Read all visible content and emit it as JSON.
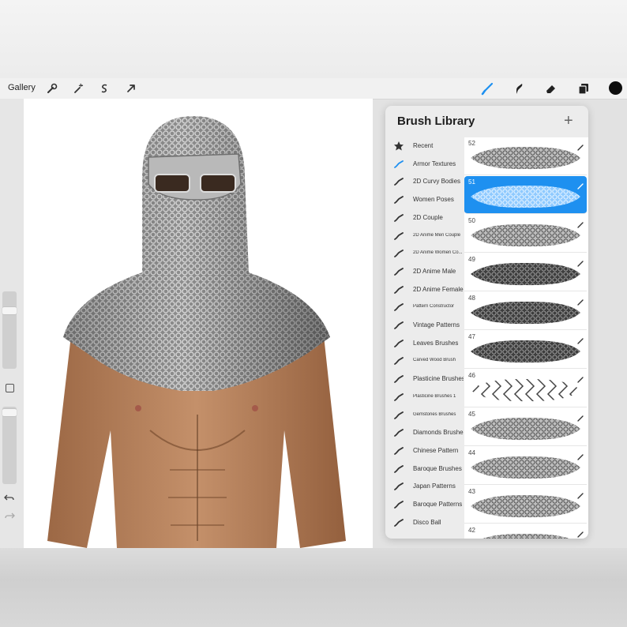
{
  "toolbar": {
    "gallery_label": "Gallery",
    "icons": [
      "wrench-icon",
      "magic-wand-icon",
      "selection-s-icon",
      "arrow-cursor-icon",
      "brush-icon",
      "smudge-icon",
      "eraser-icon",
      "layers-icon"
    ],
    "active_tool": "brush-icon",
    "accent_color": "#1e90f0",
    "current_color": "#0d0d0d"
  },
  "brush_library": {
    "title": "Brush Library",
    "add_label": "+",
    "sets": [
      {
        "label": "Recent",
        "icon": "star-icon"
      },
      {
        "label": "Armor Textures",
        "icon": "brush-stroke-icon",
        "active": true
      },
      {
        "label": "2D Curvy Bodies",
        "icon": "brush-stroke-icon"
      },
      {
        "label": "Women Poses",
        "icon": "brush-stroke-icon"
      },
      {
        "label": "2D Couple",
        "icon": "brush-stroke-icon"
      },
      {
        "label": "2D Anime Men Couple",
        "icon": "brush-stroke-icon",
        "small": true
      },
      {
        "label": "2D Anime Women Co...",
        "icon": "brush-stroke-icon",
        "small": true
      },
      {
        "label": "2D Anime Male",
        "icon": "brush-stroke-icon"
      },
      {
        "label": "2D Anime Female",
        "icon": "brush-stroke-icon"
      },
      {
        "label": "Pattern Constructor",
        "icon": "brush-stroke-icon",
        "small": true
      },
      {
        "label": "Vintage Patterns",
        "icon": "brush-stroke-icon"
      },
      {
        "label": "Leaves Brushes",
        "icon": "brush-stroke-icon"
      },
      {
        "label": "Carved Wood Brush",
        "icon": "brush-stroke-icon",
        "small": true
      },
      {
        "label": "Plasticine Brushes",
        "icon": "brush-stroke-icon"
      },
      {
        "label": "Plasticine Brushes 1",
        "icon": "brush-stroke-icon",
        "small": true
      },
      {
        "label": "Gemstones Brushes",
        "icon": "brush-stroke-icon",
        "small": true
      },
      {
        "label": "Diamonds Brushes",
        "icon": "brush-stroke-icon"
      },
      {
        "label": "Chinese Pattern",
        "icon": "brush-stroke-icon"
      },
      {
        "label": "Baroque Brushes",
        "icon": "brush-stroke-icon"
      },
      {
        "label": "Japan Patterns",
        "icon": "brush-stroke-icon"
      },
      {
        "label": "Baroque Patterns",
        "icon": "brush-stroke-icon"
      },
      {
        "label": "Disco Ball",
        "icon": "brush-stroke-icon"
      }
    ],
    "brushes": [
      {
        "number": "52"
      },
      {
        "number": "51",
        "selected": true
      },
      {
        "number": "50"
      },
      {
        "number": "49"
      },
      {
        "number": "48"
      },
      {
        "number": "47"
      },
      {
        "number": "46"
      },
      {
        "number": "45"
      },
      {
        "number": "44"
      },
      {
        "number": "43"
      },
      {
        "number": "42"
      }
    ]
  }
}
